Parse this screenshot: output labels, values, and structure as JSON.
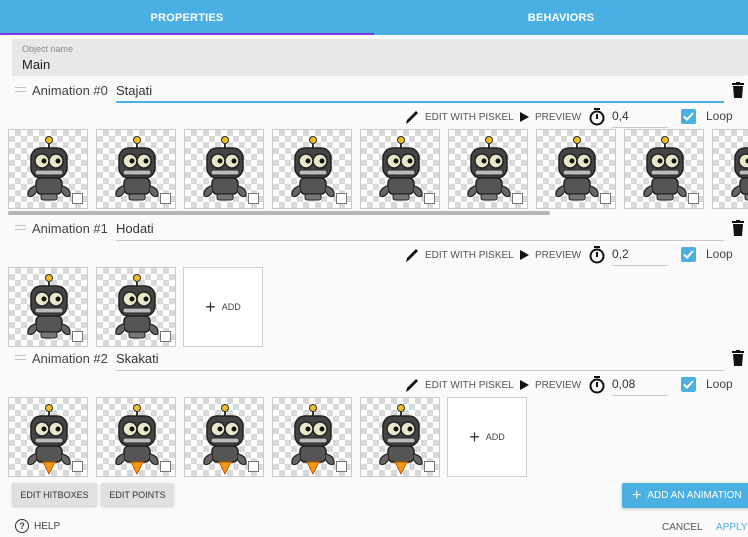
{
  "tabs": [
    {
      "label": "PROPERTIES",
      "active": true
    },
    {
      "label": "BEHAVIORS",
      "active": false
    }
  ],
  "object_name": {
    "label": "Object name",
    "value": "Main"
  },
  "animations": [
    {
      "label": "Animation #0",
      "name": "Stajati",
      "timer": "0,4",
      "loop": true,
      "frame_count": 9,
      "add_tile": false
    },
    {
      "label": "Animation #1",
      "name": "Hodati",
      "timer": "0,2",
      "loop": true,
      "frame_count": 2,
      "add_tile": true
    },
    {
      "label": "Animation #2",
      "name": "Skakati",
      "timer": "0,08",
      "loop": true,
      "frame_count": 5,
      "add_tile": true
    }
  ],
  "tools": {
    "edit_label": "EDIT WITH PISKEL",
    "preview_label": "PREVIEW",
    "loop_label": "Loop",
    "add_label": "ADD"
  },
  "footer": {
    "edit_hitboxes": "EDIT HITBOXES",
    "edit_points": "EDIT POINTS",
    "add_animation": "ADD AN ANIMATION",
    "help": "HELP",
    "cancel": "CANCEL",
    "apply": "APPLY"
  },
  "colors": {
    "accent": "#4ab0e4",
    "tab_indicator": "#7c3aed"
  },
  "icons": [
    "pencil-icon",
    "play-icon",
    "timer-icon",
    "trash-icon",
    "checkbox-icon",
    "plus-icon",
    "help-icon"
  ]
}
